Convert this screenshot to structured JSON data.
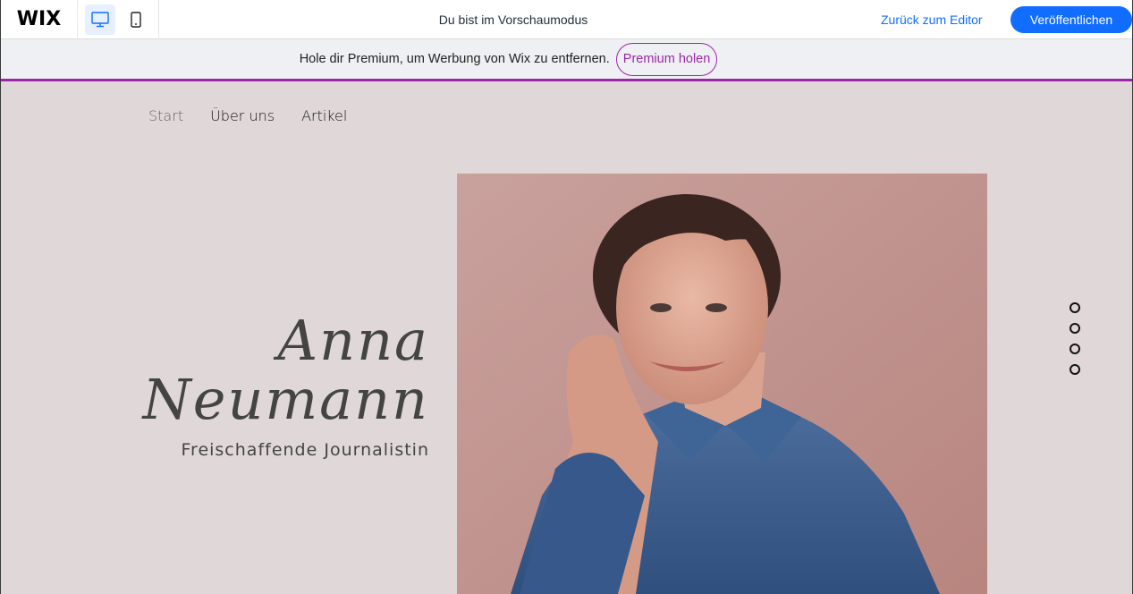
{
  "topbar": {
    "logo": "WIX",
    "preview_label": "Du bist im Vorschaumodus",
    "back_link": "Zurück zum Editor",
    "publish_label": "Veröffentlichen"
  },
  "premium": {
    "text": "Hole dir Premium, um Werbung von Wix zu entfernen.",
    "button_label": "Premium holen",
    "accent": "#9a27a8"
  },
  "site": {
    "nav": [
      {
        "label": "Start"
      },
      {
        "label": "Über uns"
      },
      {
        "label": "Artikel"
      }
    ],
    "hero": {
      "first_name": "Anna",
      "last_name": "Neumann",
      "role": "Freischaffende Journalistin"
    },
    "slide_count": 4
  },
  "colors": {
    "primary_blue": "#116dff",
    "site_background": "#e0d8d8",
    "photo_background": "#c09390"
  },
  "icons": {
    "desktop": "desktop-icon",
    "mobile": "mobile-icon"
  }
}
